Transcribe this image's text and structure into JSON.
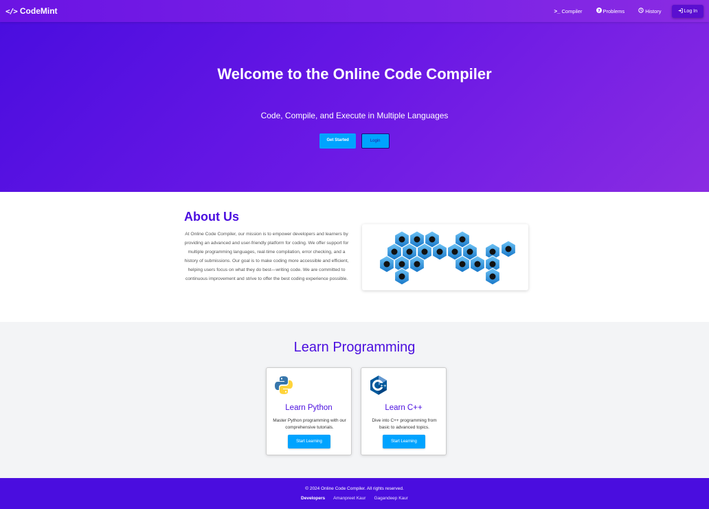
{
  "navbar": {
    "brand": "CodeMint",
    "brand_icon": "code-icon",
    "links": [
      {
        "label": "Compiler",
        "icon": "terminal-icon"
      },
      {
        "label": "Problems",
        "icon": "question-circle-icon"
      },
      {
        "label": "History",
        "icon": "history-icon"
      }
    ],
    "login_label": "Log In"
  },
  "hero": {
    "title": "Welcome to the Online Code Compiler",
    "subtitle": "Code, Compile, and Execute in Multiple Languages",
    "get_started": "Get Started",
    "login": "Login"
  },
  "about": {
    "title": "About Us",
    "text": "At Online Code Compiler, our mission is to empower developers and learners by providing an advanced and user-friendly platform for coding. We offer support for multiple programming languages, real-time compilation, error checking, and a history of submissions. Our goal is to make coding more accessible and efficient, helping users focus on what they do best—writing code. We are committed to continuous improvement and strive to offer the best coding experience possible."
  },
  "learn": {
    "title": "Learn Programming",
    "cards": [
      {
        "title": "Learn Python",
        "desc": "Master Python programming with our comprehensive tutorials.",
        "button": "Start Learning",
        "icon": "python-logo-icon"
      },
      {
        "title": "Learn C++",
        "desc": "Dive into C++ programming from basic to advanced topics.",
        "button": "Start Learning",
        "icon": "cpp-logo-icon"
      }
    ]
  },
  "footer": {
    "copyright": "© 2024 Online Code Compiler. All rights reserved.",
    "developers_label": "Developers",
    "developers": [
      "Amanpreet Kaur",
      "Gagandeep Kaur"
    ]
  },
  "colors": {
    "primary": "#4a0ddf",
    "accent": "#00a3ff",
    "hero_end": "#8a2ce2",
    "hex_blue": "#1e8fe0"
  }
}
